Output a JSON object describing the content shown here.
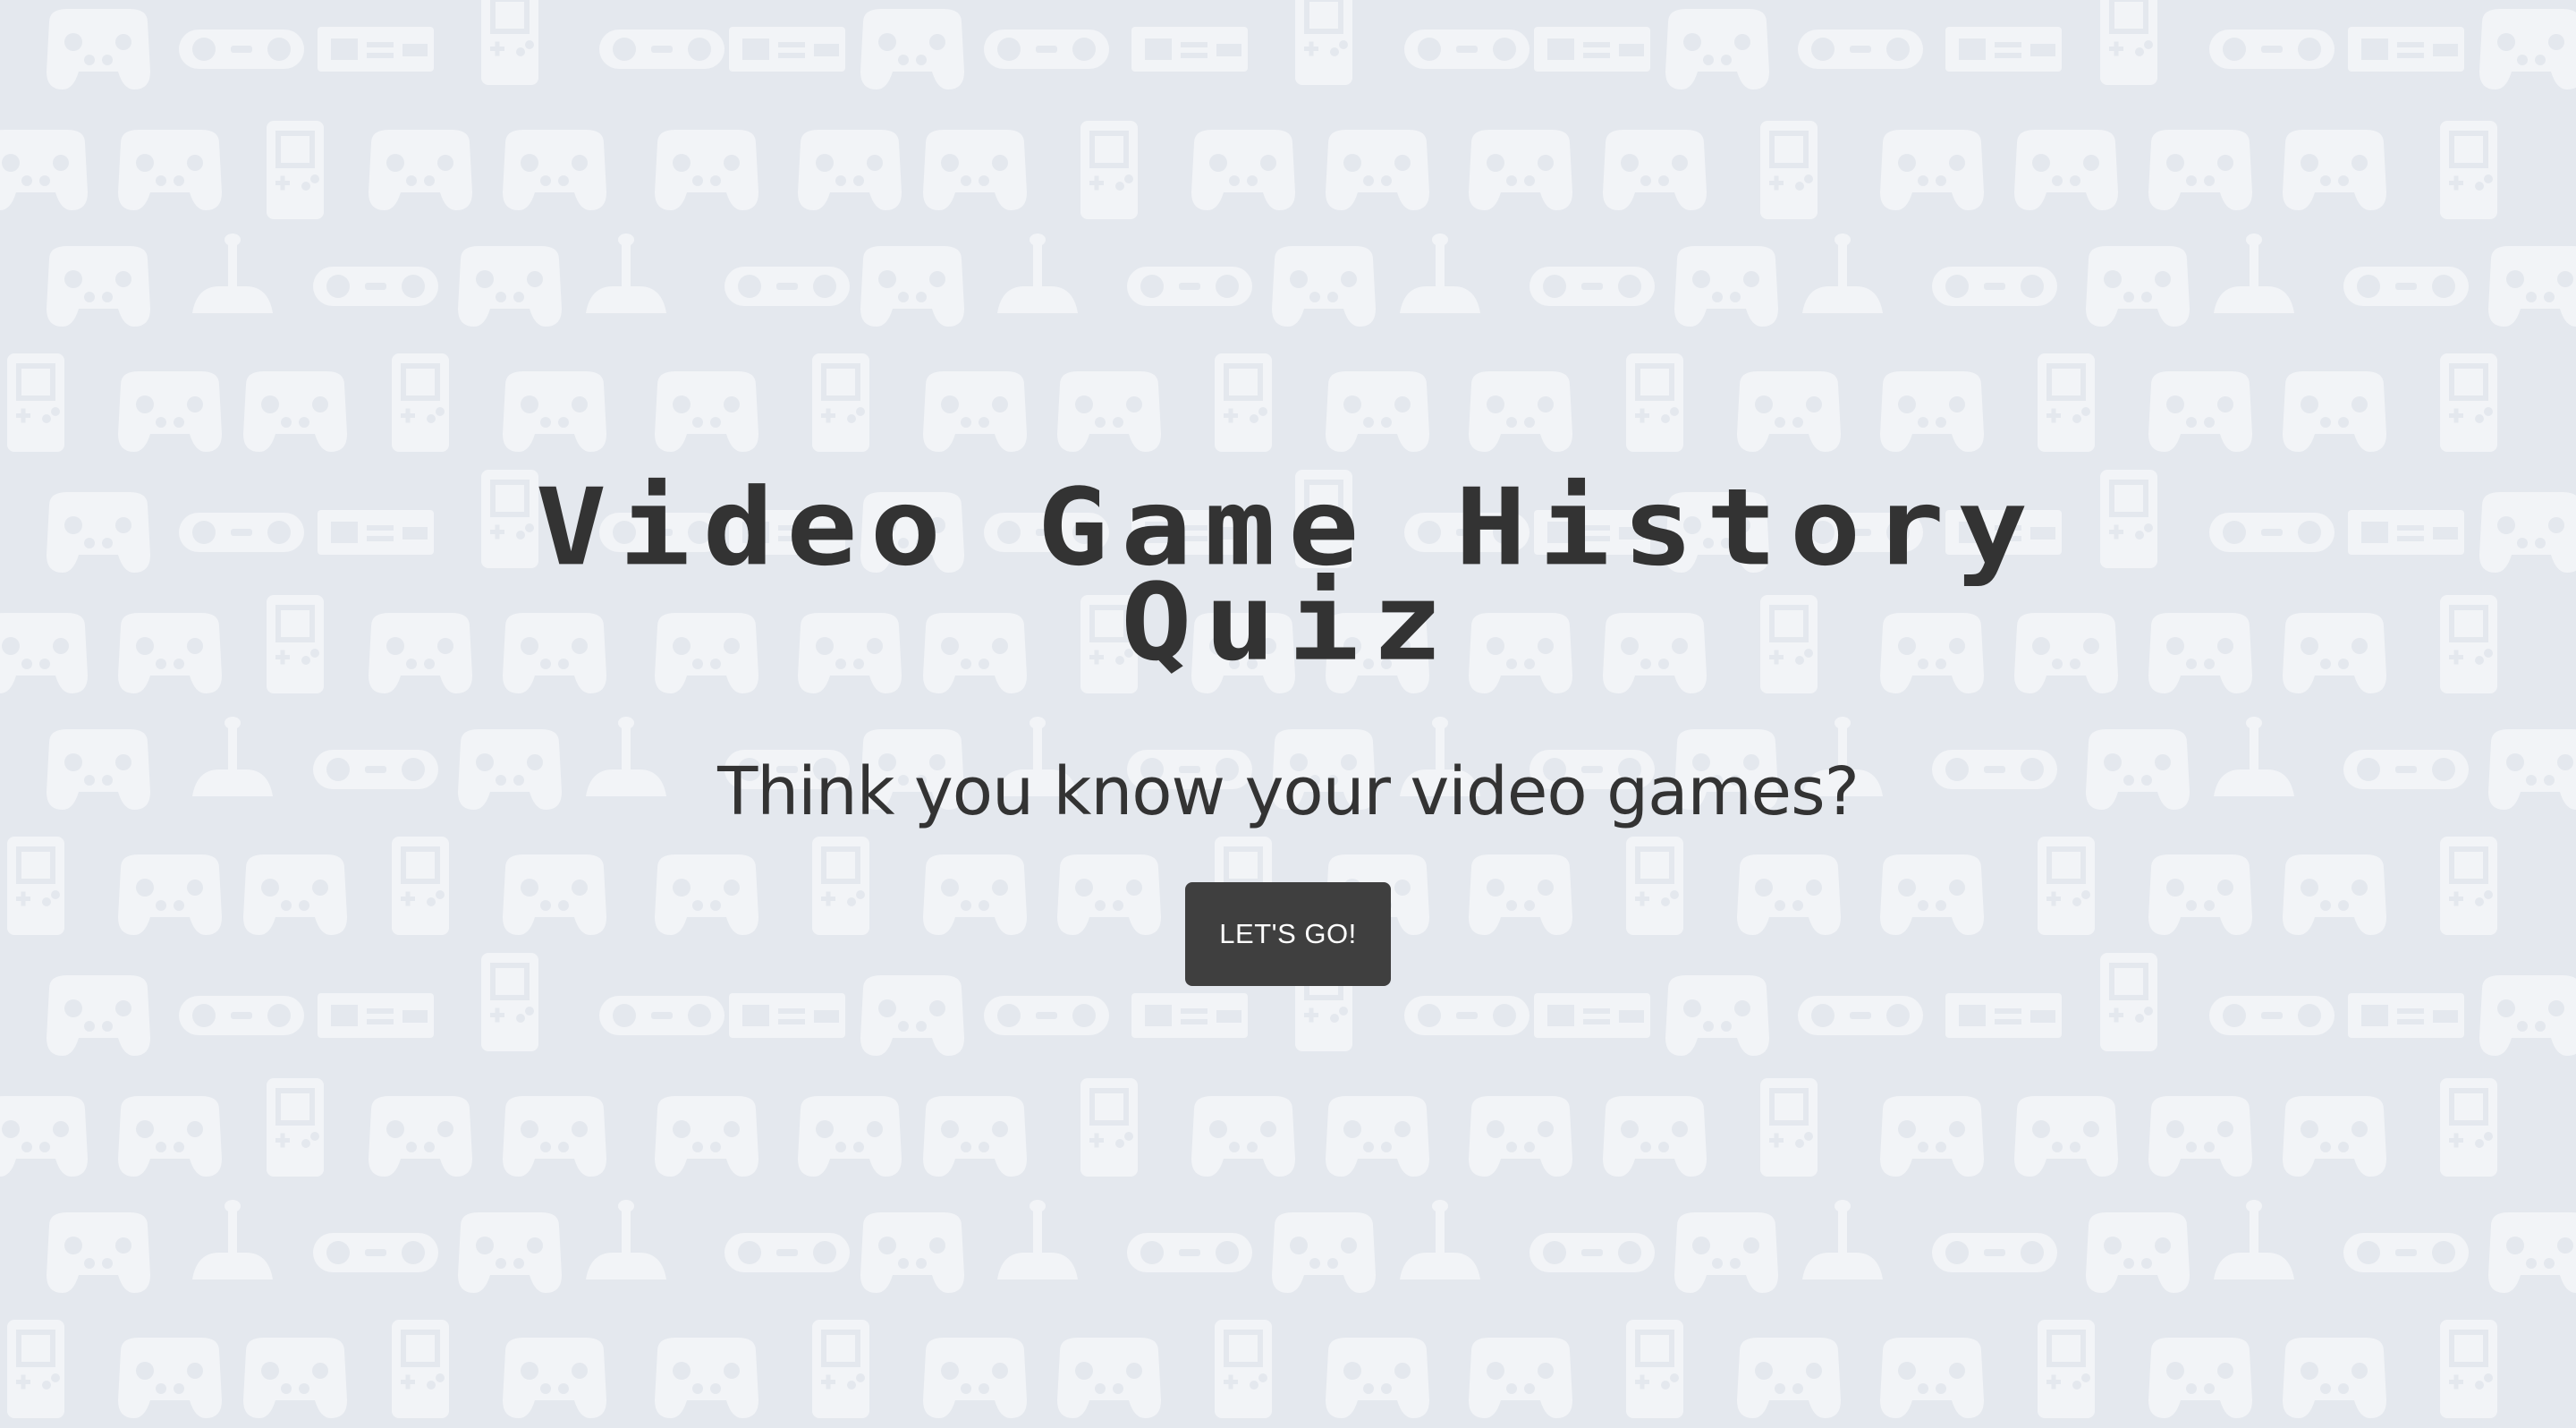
{
  "page": {
    "title": "Video Game History Quiz",
    "subtitle": "Think you know your video games?",
    "start_button_label": "LET'S GO!"
  },
  "background": {
    "pattern_icons": [
      "gamepad-icon",
      "handheld-console-icon",
      "joystick-icon",
      "controller-icon"
    ]
  },
  "colors": {
    "background": "#e4e8ee",
    "pattern": "#f2f4f7",
    "text": "#333333",
    "button": "#3f3f3f",
    "button_text": "#ffffff"
  }
}
